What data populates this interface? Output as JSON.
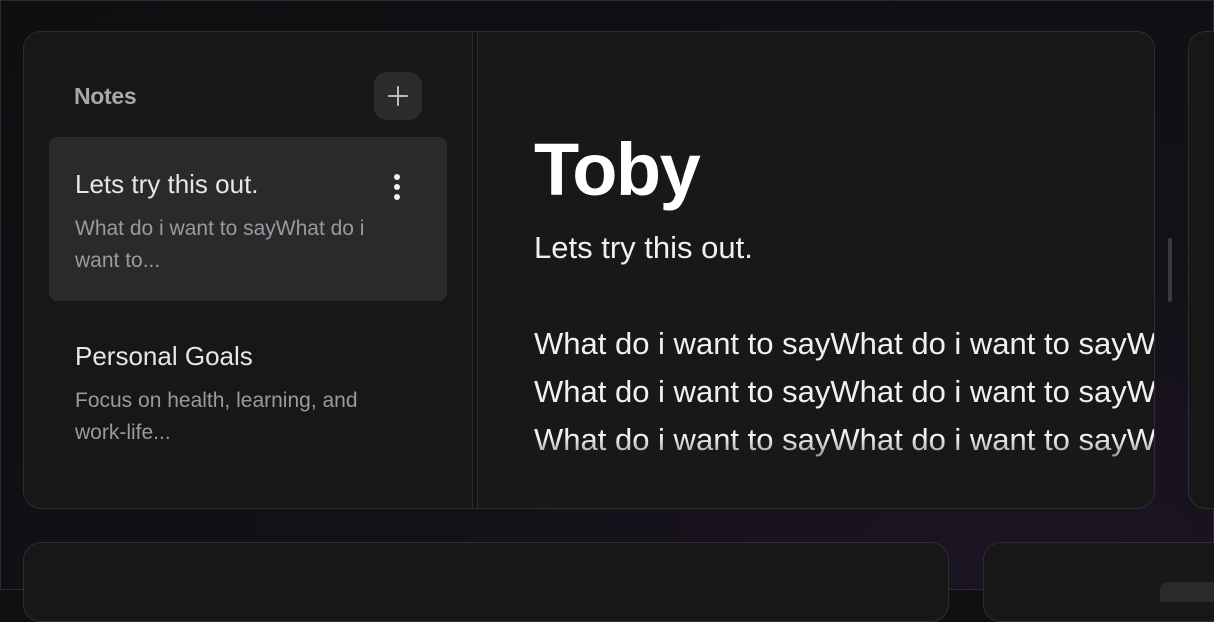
{
  "sidebar": {
    "title": "Notes",
    "add_button_icon": "plus-icon",
    "notes": [
      {
        "title": "Lets try this out.",
        "preview": "What do i want to sayWhat do i want to...",
        "active": true
      },
      {
        "title": "Personal Goals",
        "preview": "Focus on health, learning, and work-life...",
        "active": false
      }
    ]
  },
  "editor": {
    "title": "Toby",
    "subtitle": "Lets try this out.",
    "body": "What do i want to sayWhat do i want to sayWhat do i want to sayWhat do i want to sayWhat do i want to sayWhat do i want to sayWhat do i want to sayWhat do i want to sayWhat do i wa"
  },
  "colors": {
    "background": "#101013",
    "card": "#171717",
    "active_item": "#2a2a2c",
    "text_primary": "#f0f0f0",
    "text_muted": "#9a9a9e"
  }
}
